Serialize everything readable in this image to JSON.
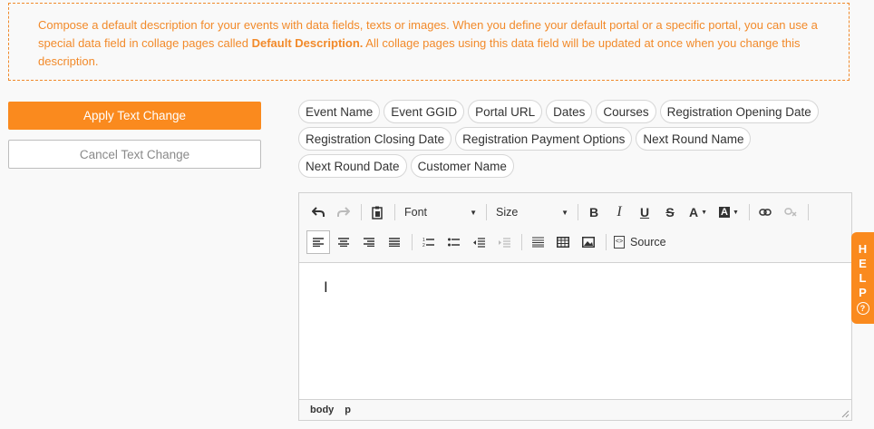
{
  "info": {
    "text_before": "Compose a default description for your events with data fields, texts or images. When you define your default portal or a specific portal, you can use a special data field in collage pages called ",
    "bold": "Default Description.",
    "text_after": " All collage pages using this data field will be updated at once when you change this description."
  },
  "buttons": {
    "apply": "Apply Text Change",
    "cancel": "Cancel Text Change"
  },
  "chips": [
    [
      "Event Name",
      "Event GGID",
      "Portal URL",
      "Dates",
      "Courses",
      "Registration Opening Date"
    ],
    [
      "Registration Closing Date",
      "Registration Payment Options",
      "Next Round Name"
    ],
    [
      "Next Round Date",
      "Customer Name"
    ]
  ],
  "toolbar": {
    "font_label": "Font",
    "size_label": "Size",
    "source_label": "Source",
    "icons": [
      "undo-icon",
      "redo-icon",
      "paste-icon",
      "bold-icon",
      "italic-icon",
      "underline-icon",
      "strikethrough-icon",
      "text-color-icon",
      "background-color-icon",
      "link-icon",
      "unlink-icon",
      "align-left-icon",
      "align-center-icon",
      "align-right-icon",
      "justify-icon",
      "numbered-list-icon",
      "bullet-list-icon",
      "outdent-icon",
      "indent-icon",
      "horizontal-rule-icon",
      "table-icon",
      "image-icon",
      "source-icon"
    ]
  },
  "status": {
    "path": [
      "body",
      "p"
    ]
  },
  "help": {
    "letters": [
      "H",
      "E",
      "L",
      "P"
    ],
    "icon": "?"
  },
  "colors": {
    "accent": "#fa8a1e",
    "info_text": "#f28a2a"
  }
}
